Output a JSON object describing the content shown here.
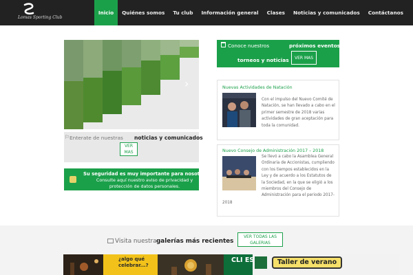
{
  "header": {
    "logo_text": "Lomas Sporting Club",
    "nav": [
      {
        "label": "Inicio",
        "active": true
      },
      {
        "label": "Quiénes somos",
        "active": false
      },
      {
        "label": "Tu club",
        "active": false
      },
      {
        "label": "Información general",
        "active": false
      },
      {
        "label": "Clases",
        "active": false
      },
      {
        "label": "Noticias y comunicados",
        "active": false
      },
      {
        "label": "Contáctanos",
        "active": false
      }
    ]
  },
  "left": {
    "news_lead": "Enterate de nuestras",
    "news_strong": "noticias y comunicados",
    "news_button": "VER MAS",
    "security_title": "Su seguridad es muy importante para nosotros:",
    "security_sub": "Consulte aquí nuestro aviso de privacidad y protección de datos personales."
  },
  "events": {
    "lead": "Conoce nuestros",
    "strong1": "próximos eventos,",
    "strong2": "torneos y noticias",
    "button": "VER MAS"
  },
  "cards": [
    {
      "title": "Nuevas Actividades de Natación",
      "text": "Con el impulso del Nuevo Comité de Natación, se han llevado a cabo en el primer semestre de 2018 varias actividades de gran aceptación para toda la comunidad."
    },
    {
      "title": "Nuevo Consejo de Administración 2017 – 2018",
      "text": "Se llevó a cabo la Asamblea General Ordinaria de Accionistas, cumpliendo con los tiempos establecidos en la Ley y de acuerdo a los Estatutos de la Sociedad, en la que se eligió a los miembros del Consejo de Administración para el periodo 2017-",
      "text_tail": "2018"
    }
  ],
  "galleries": {
    "lead": "Visita nuestra",
    "strong": "galerías más recientes",
    "button": "VER TODAS LAS GALERIAS",
    "thumbs": [
      {
        "text": ""
      },
      {
        "text": "¿algo qué celebrar...?"
      },
      {
        "text": ""
      },
      {
        "text": "CLI ESPECIALIZ"
      },
      {
        "text": "Taller de verano"
      }
    ]
  },
  "colors": {
    "accent": "#1ba04a",
    "header": "#222222"
  }
}
